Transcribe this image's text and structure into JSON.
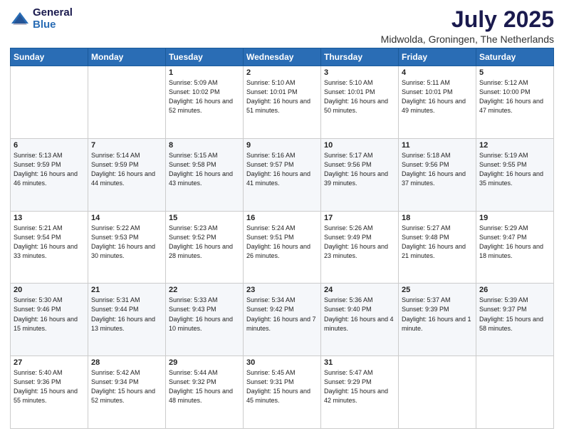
{
  "logo": {
    "general": "General",
    "blue": "Blue"
  },
  "header": {
    "month": "July 2025",
    "location": "Midwolda, Groningen, The Netherlands"
  },
  "weekdays": [
    "Sunday",
    "Monday",
    "Tuesday",
    "Wednesday",
    "Thursday",
    "Friday",
    "Saturday"
  ],
  "weeks": [
    [
      {
        "day": "",
        "info": ""
      },
      {
        "day": "",
        "info": ""
      },
      {
        "day": "1",
        "info": "Sunrise: 5:09 AM\nSunset: 10:02 PM\nDaylight: 16 hours and 52 minutes."
      },
      {
        "day": "2",
        "info": "Sunrise: 5:10 AM\nSunset: 10:01 PM\nDaylight: 16 hours and 51 minutes."
      },
      {
        "day": "3",
        "info": "Sunrise: 5:10 AM\nSunset: 10:01 PM\nDaylight: 16 hours and 50 minutes."
      },
      {
        "day": "4",
        "info": "Sunrise: 5:11 AM\nSunset: 10:01 PM\nDaylight: 16 hours and 49 minutes."
      },
      {
        "day": "5",
        "info": "Sunrise: 5:12 AM\nSunset: 10:00 PM\nDaylight: 16 hours and 47 minutes."
      }
    ],
    [
      {
        "day": "6",
        "info": "Sunrise: 5:13 AM\nSunset: 9:59 PM\nDaylight: 16 hours and 46 minutes."
      },
      {
        "day": "7",
        "info": "Sunrise: 5:14 AM\nSunset: 9:59 PM\nDaylight: 16 hours and 44 minutes."
      },
      {
        "day": "8",
        "info": "Sunrise: 5:15 AM\nSunset: 9:58 PM\nDaylight: 16 hours and 43 minutes."
      },
      {
        "day": "9",
        "info": "Sunrise: 5:16 AM\nSunset: 9:57 PM\nDaylight: 16 hours and 41 minutes."
      },
      {
        "day": "10",
        "info": "Sunrise: 5:17 AM\nSunset: 9:56 PM\nDaylight: 16 hours and 39 minutes."
      },
      {
        "day": "11",
        "info": "Sunrise: 5:18 AM\nSunset: 9:56 PM\nDaylight: 16 hours and 37 minutes."
      },
      {
        "day": "12",
        "info": "Sunrise: 5:19 AM\nSunset: 9:55 PM\nDaylight: 16 hours and 35 minutes."
      }
    ],
    [
      {
        "day": "13",
        "info": "Sunrise: 5:21 AM\nSunset: 9:54 PM\nDaylight: 16 hours and 33 minutes."
      },
      {
        "day": "14",
        "info": "Sunrise: 5:22 AM\nSunset: 9:53 PM\nDaylight: 16 hours and 30 minutes."
      },
      {
        "day": "15",
        "info": "Sunrise: 5:23 AM\nSunset: 9:52 PM\nDaylight: 16 hours and 28 minutes."
      },
      {
        "day": "16",
        "info": "Sunrise: 5:24 AM\nSunset: 9:51 PM\nDaylight: 16 hours and 26 minutes."
      },
      {
        "day": "17",
        "info": "Sunrise: 5:26 AM\nSunset: 9:49 PM\nDaylight: 16 hours and 23 minutes."
      },
      {
        "day": "18",
        "info": "Sunrise: 5:27 AM\nSunset: 9:48 PM\nDaylight: 16 hours and 21 minutes."
      },
      {
        "day": "19",
        "info": "Sunrise: 5:29 AM\nSunset: 9:47 PM\nDaylight: 16 hours and 18 minutes."
      }
    ],
    [
      {
        "day": "20",
        "info": "Sunrise: 5:30 AM\nSunset: 9:46 PM\nDaylight: 16 hours and 15 minutes."
      },
      {
        "day": "21",
        "info": "Sunrise: 5:31 AM\nSunset: 9:44 PM\nDaylight: 16 hours and 13 minutes."
      },
      {
        "day": "22",
        "info": "Sunrise: 5:33 AM\nSunset: 9:43 PM\nDaylight: 16 hours and 10 minutes."
      },
      {
        "day": "23",
        "info": "Sunrise: 5:34 AM\nSunset: 9:42 PM\nDaylight: 16 hours and 7 minutes."
      },
      {
        "day": "24",
        "info": "Sunrise: 5:36 AM\nSunset: 9:40 PM\nDaylight: 16 hours and 4 minutes."
      },
      {
        "day": "25",
        "info": "Sunrise: 5:37 AM\nSunset: 9:39 PM\nDaylight: 16 hours and 1 minute."
      },
      {
        "day": "26",
        "info": "Sunrise: 5:39 AM\nSunset: 9:37 PM\nDaylight: 15 hours and 58 minutes."
      }
    ],
    [
      {
        "day": "27",
        "info": "Sunrise: 5:40 AM\nSunset: 9:36 PM\nDaylight: 15 hours and 55 minutes."
      },
      {
        "day": "28",
        "info": "Sunrise: 5:42 AM\nSunset: 9:34 PM\nDaylight: 15 hours and 52 minutes."
      },
      {
        "day": "29",
        "info": "Sunrise: 5:44 AM\nSunset: 9:32 PM\nDaylight: 15 hours and 48 minutes."
      },
      {
        "day": "30",
        "info": "Sunrise: 5:45 AM\nSunset: 9:31 PM\nDaylight: 15 hours and 45 minutes."
      },
      {
        "day": "31",
        "info": "Sunrise: 5:47 AM\nSunset: 9:29 PM\nDaylight: 15 hours and 42 minutes."
      },
      {
        "day": "",
        "info": ""
      },
      {
        "day": "",
        "info": ""
      }
    ]
  ]
}
